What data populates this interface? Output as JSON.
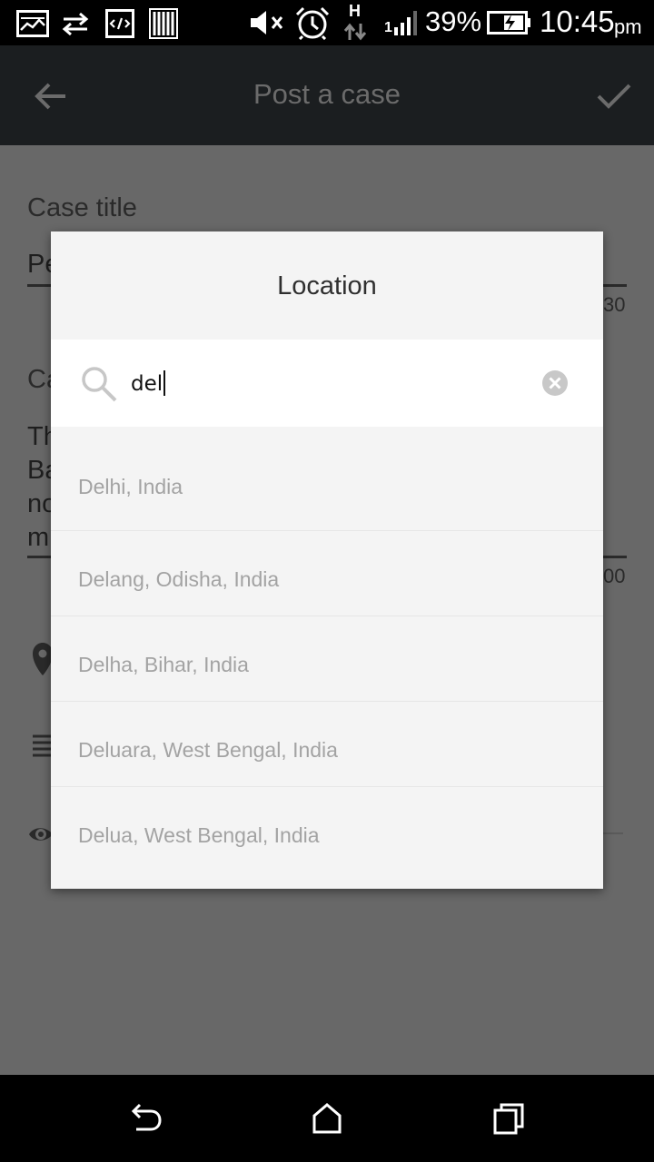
{
  "status_bar": {
    "battery_percent": "39%",
    "time": "10:45",
    "time_suffix": "pm",
    "network_type": "H",
    "sim_slot": "1",
    "icons": [
      "screenshot-icon",
      "data-sync-icon",
      "developer-icon",
      "barcode-icon",
      "mute-icon",
      "alarm-icon",
      "network-h-icon",
      "signal-icon",
      "battery-charging-icon"
    ]
  },
  "app_bar": {
    "title": "Post a case",
    "back_icon": "arrow-left-icon",
    "confirm_icon": "check-icon"
  },
  "form": {
    "case_title_label": "Case title",
    "title_value_fragment": "Pe",
    "title_counter_fragment": "30",
    "case_desc_label_fragment": "Ca",
    "desc_line_1": "Th",
    "desc_line_2": "Ba",
    "desc_line_3": "no",
    "desc_line_4": "m",
    "desc_counter_fragment": "00",
    "row_icons": [
      "location-pin-icon",
      "list-icon",
      "eye-icon"
    ]
  },
  "dialog": {
    "title": "Location",
    "search": {
      "value": "del",
      "icon": "search-icon",
      "clear_icon": "clear-icon"
    },
    "results": [
      "Delhi, India",
      "Delang, Odisha, India",
      "Delha, Bihar, India",
      "Deluara, West Bengal, India",
      "Delua, West Bengal, India"
    ]
  },
  "nav_bar": {
    "icons": [
      "back-nav-icon",
      "home-icon",
      "recents-icon"
    ]
  },
  "colors": {
    "status_bar_bg": "#000000",
    "app_bar_bg": "#1b1e20",
    "scrim_bg": "#686868",
    "dialog_bg": "#f4f4f4",
    "result_text": "#a3a3a3"
  }
}
